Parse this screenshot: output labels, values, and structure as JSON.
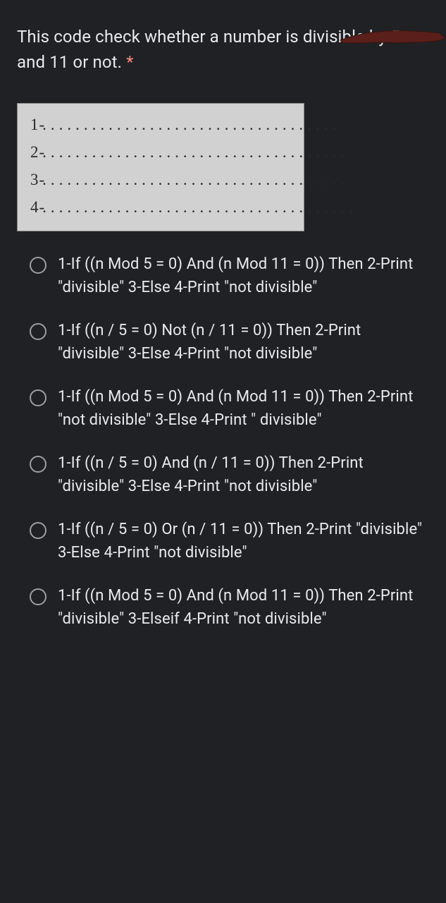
{
  "question": {
    "text": "This code check whether a number is divisible by 5 and 11 or not.",
    "required_mark": "*"
  },
  "code_lines": [
    {
      "num": "1-",
      "dots": "...................................."
    },
    {
      "num": "2-",
      "dots": "....................................."
    },
    {
      "num": "3-",
      "dots": "....................................."
    },
    {
      "num": "4-",
      "dots": "......................................"
    }
  ],
  "options": [
    {
      "label": "1-If ((n Mod 5 = 0) And (n Mod 11 = 0)) Then 2-Print \"divisible\" 3-Else 4-Print \"not divisible\""
    },
    {
      "label": "1-If ((n / 5 = 0) Not (n / 11 = 0)) Then 2-Print \"divisible\" 3-Else 4-Print \"not divisible\""
    },
    {
      "label": "1-If ((n Mod 5 = 0) And (n Mod 11 = 0)) Then 2-Print \"not divisible\" 3-Else 4-Print \" divisible\""
    },
    {
      "label": "1-If ((n / 5 = 0) And (n / 11 = 0)) Then 2-Print \"divisible\" 3-Else 4-Print \"not divisible\""
    },
    {
      "label": "1-If ((n / 5 = 0) Or (n / 11 = 0)) Then 2-Print \"divisible\" 3-Else 4-Print \"not divisible\""
    },
    {
      "label": "1-If ((n Mod 5 = 0) And (n Mod 11 = 0)) Then 2-Print \"divisible\" 3-Elseif 4-Print \"not divisible\""
    }
  ]
}
